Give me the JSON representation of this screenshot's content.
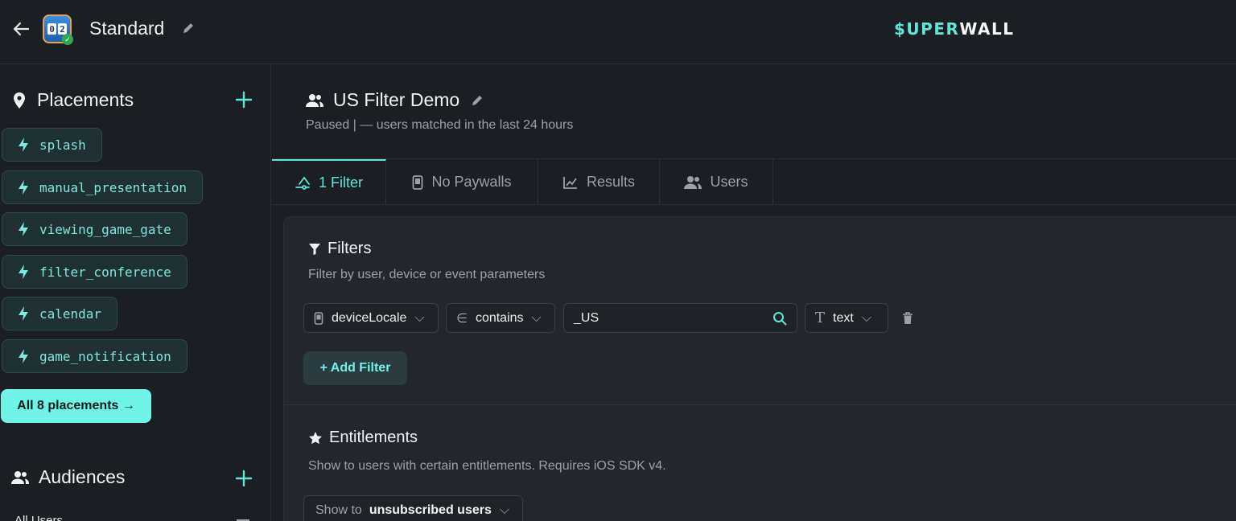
{
  "header": {
    "app_name": "Standard",
    "app_icon_digits": [
      "0",
      "2"
    ],
    "brand_part1": "$UPER",
    "brand_part2": "WALL",
    "colors": {
      "accent": "#5ee6d8",
      "background": "#1b1e22"
    }
  },
  "sidebar": {
    "placements_title": "Placements",
    "placements": [
      {
        "name": "splash"
      },
      {
        "name": "manual_presentation"
      },
      {
        "name": "viewing_game_gate"
      },
      {
        "name": "filter_conference"
      },
      {
        "name": "calendar"
      },
      {
        "name": "game_notification"
      }
    ],
    "all_placements_label": "All 8 placements →",
    "audiences_title": "Audiences",
    "audience_partial": "All Users"
  },
  "audience": {
    "title": "US Filter Demo",
    "status": "Paused | — users matched in the last 24 hours"
  },
  "tabs": [
    {
      "label": "1 Filter",
      "icon": "filter-funnel-icon",
      "active": true
    },
    {
      "label": "No Paywalls",
      "icon": "phone-icon",
      "active": false
    },
    {
      "label": "Results",
      "icon": "line-chart-icon",
      "active": false
    },
    {
      "label": "Users",
      "icon": "users-icon",
      "active": false
    }
  ],
  "filters": {
    "title": "Filters",
    "subtitle": "Filter by user, device or event parameters",
    "rule": {
      "field": "deviceLocale",
      "operator_symbol": "∈",
      "operator": "contains",
      "value": "_US",
      "type_symbol": "T",
      "type": "text"
    },
    "add_label": "+ Add Filter"
  },
  "entitlements": {
    "title": "Entitlements",
    "subtitle": "Show to users with certain entitlements. Requires iOS SDK v4.",
    "show_to_label": "Show to",
    "show_to_value": "unsubscribed users"
  }
}
